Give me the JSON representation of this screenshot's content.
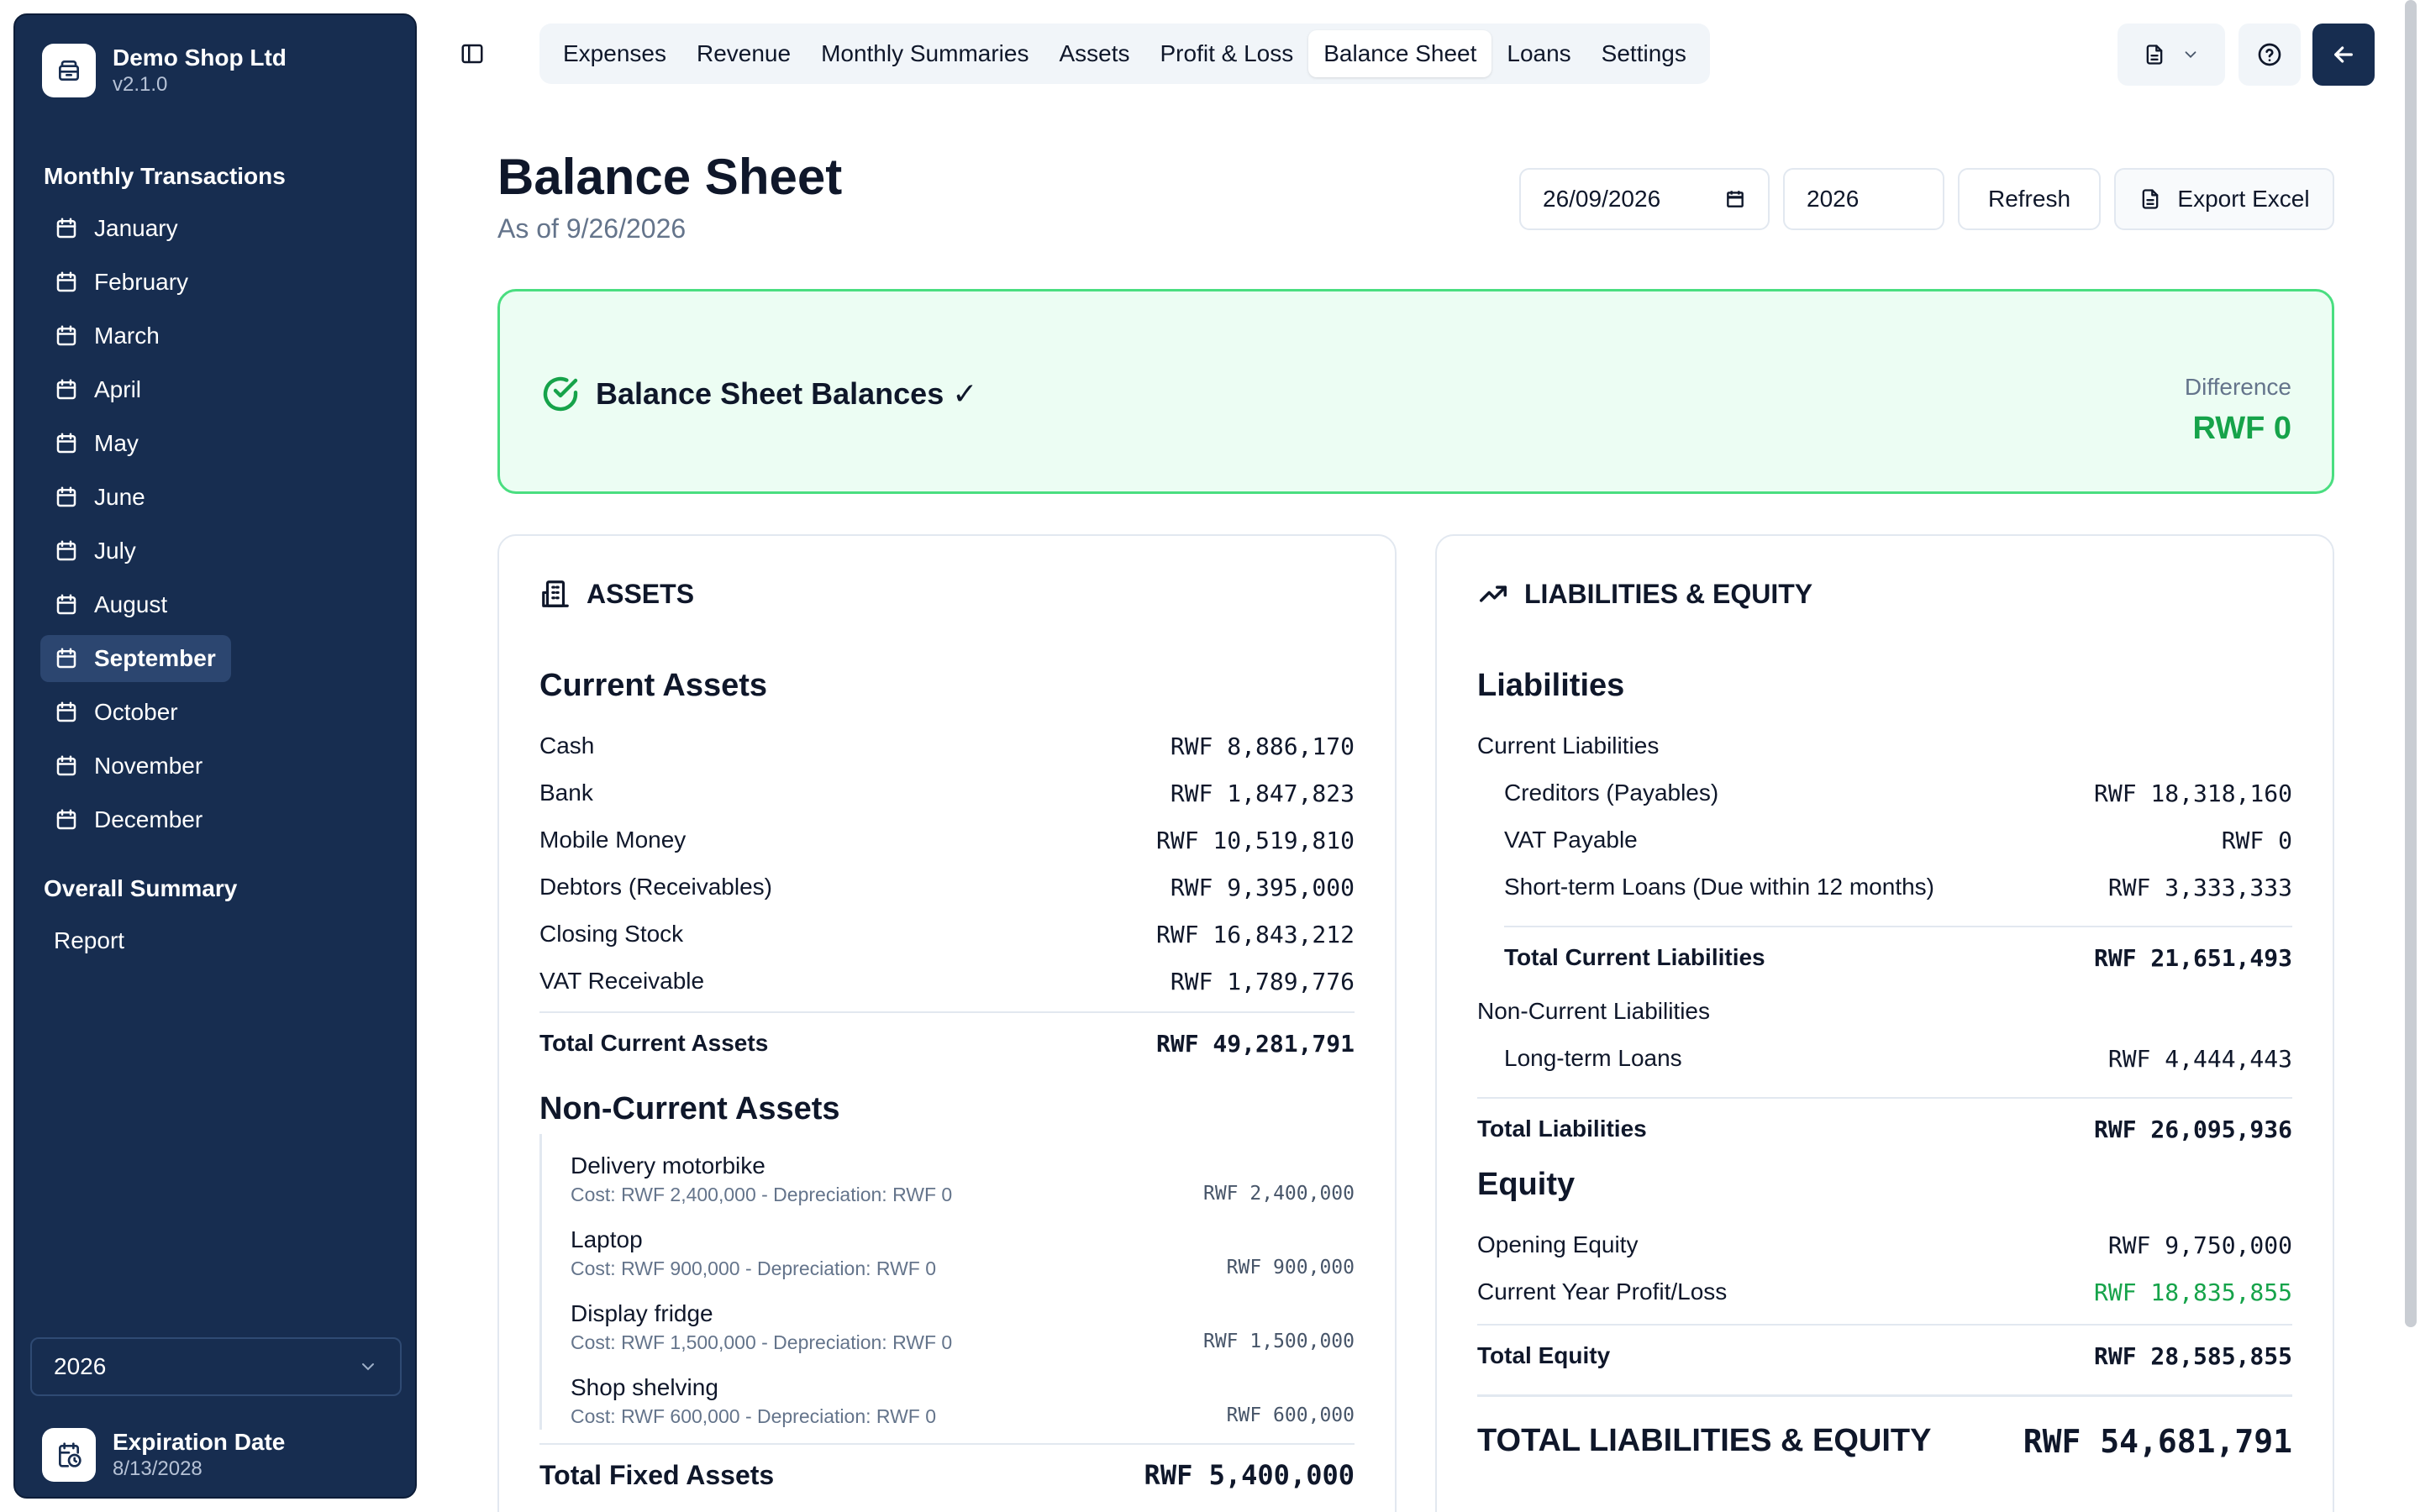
{
  "brand": {
    "name": "Demo Shop Ltd",
    "version": "v2.1.0"
  },
  "sidebar": {
    "monthly_title": "Monthly Transactions",
    "months": [
      "January",
      "February",
      "March",
      "April",
      "May",
      "June",
      "July",
      "August",
      "September",
      "October",
      "November",
      "December"
    ],
    "active_month": "September",
    "overall_title": "Overall Summary",
    "report_label": "Report",
    "year": "2026",
    "expiry_title": "Expiration Date",
    "expiry_date": "8/13/2028"
  },
  "tabs": [
    "Expenses",
    "Revenue",
    "Monthly Summaries",
    "Assets",
    "Profit & Loss",
    "Balance Sheet",
    "Loans",
    "Settings"
  ],
  "active_tab": "Balance Sheet",
  "header": {
    "title": "Balance Sheet",
    "subtitle": "As of 9/26/2026",
    "date_value": "26/09/2026",
    "year_value": "2026",
    "refresh_label": "Refresh",
    "export_label": "Export Excel"
  },
  "banner": {
    "title": "Balance Sheet Balances ✓",
    "diff_label": "Difference",
    "diff_value": "RWF 0",
    "accent": "#16a34a"
  },
  "assets": {
    "heading": "ASSETS",
    "current_title": "Current Assets",
    "current": [
      {
        "label": "Cash",
        "value": "RWF 8,886,170"
      },
      {
        "label": "Bank",
        "value": "RWF 1,847,823"
      },
      {
        "label": "Mobile Money",
        "value": "RWF 10,519,810"
      },
      {
        "label": "Debtors (Receivables)",
        "value": "RWF 9,395,000"
      },
      {
        "label": "Closing Stock",
        "value": "RWF 16,843,212"
      },
      {
        "label": "VAT Receivable",
        "value": "RWF 1,789,776"
      }
    ],
    "total_current_label": "Total Current Assets",
    "total_current_value": "RWF 49,281,791",
    "noncurrent_title": "Non-Current Assets",
    "noncurrent": [
      {
        "name": "Delivery motorbike",
        "detail": "Cost: RWF 2,400,000 - Depreciation: RWF 0",
        "value": "RWF 2,400,000"
      },
      {
        "name": "Laptop",
        "detail": "Cost: RWF 900,000 - Depreciation: RWF 0",
        "value": "RWF 900,000"
      },
      {
        "name": "Display fridge",
        "detail": "Cost: RWF 1,500,000 - Depreciation: RWF 0",
        "value": "RWF 1,500,000"
      },
      {
        "name": "Shop shelving",
        "detail": "Cost: RWF 600,000 - Depreciation: RWF 0",
        "value": "RWF 600,000"
      }
    ],
    "total_fixed_label": "Total Fixed Assets",
    "total_fixed_value": "RWF 5,400,000"
  },
  "liabilities": {
    "heading": "LIABILITIES & EQUITY",
    "liab_title": "Liabilities",
    "current_title": "Current Liabilities",
    "current": [
      {
        "label": "Creditors (Payables)",
        "value": "RWF 18,318,160"
      },
      {
        "label": "VAT Payable",
        "value": "RWF 0"
      },
      {
        "label": "Short-term Loans (Due within 12 months)",
        "value": "RWF 3,333,333"
      }
    ],
    "total_current_label": "Total Current Liabilities",
    "total_current_value": "RWF 21,651,493",
    "noncurrent_title": "Non-Current Liabilities",
    "noncurrent": [
      {
        "label": "Long-term Loans",
        "value": "RWF 4,444,443"
      }
    ],
    "total_liab_label": "Total Liabilities",
    "total_liab_value": "RWF 26,095,936",
    "equity_title": "Equity",
    "opening_label": "Opening Equity",
    "opening_value": "RWF 9,750,000",
    "profit_label": "Current Year Profit/Loss",
    "profit_value": "RWF 18,835,855",
    "total_equity_label": "Total Equity",
    "total_equity_value": "RWF 28,585,855",
    "grand_label": "TOTAL LIABILITIES & EQUITY",
    "grand_value": "RWF 54,681,791"
  }
}
